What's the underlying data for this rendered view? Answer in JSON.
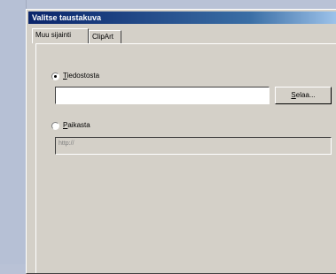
{
  "dialog": {
    "title": "Valitse taustakuva"
  },
  "tabs": [
    {
      "label": "Muu sijainti",
      "active": true
    },
    {
      "label": "ClipArt",
      "active": false
    }
  ],
  "options": {
    "from_file": {
      "label_accel": "T",
      "label_rest": "iedostosta",
      "selected": true,
      "value": ""
    },
    "browse_button": {
      "label_accel": "S",
      "label_rest": "elaa..."
    },
    "from_location": {
      "label_accel": "P",
      "label_rest": "aikasta",
      "selected": false,
      "placeholder": "http://"
    }
  }
}
